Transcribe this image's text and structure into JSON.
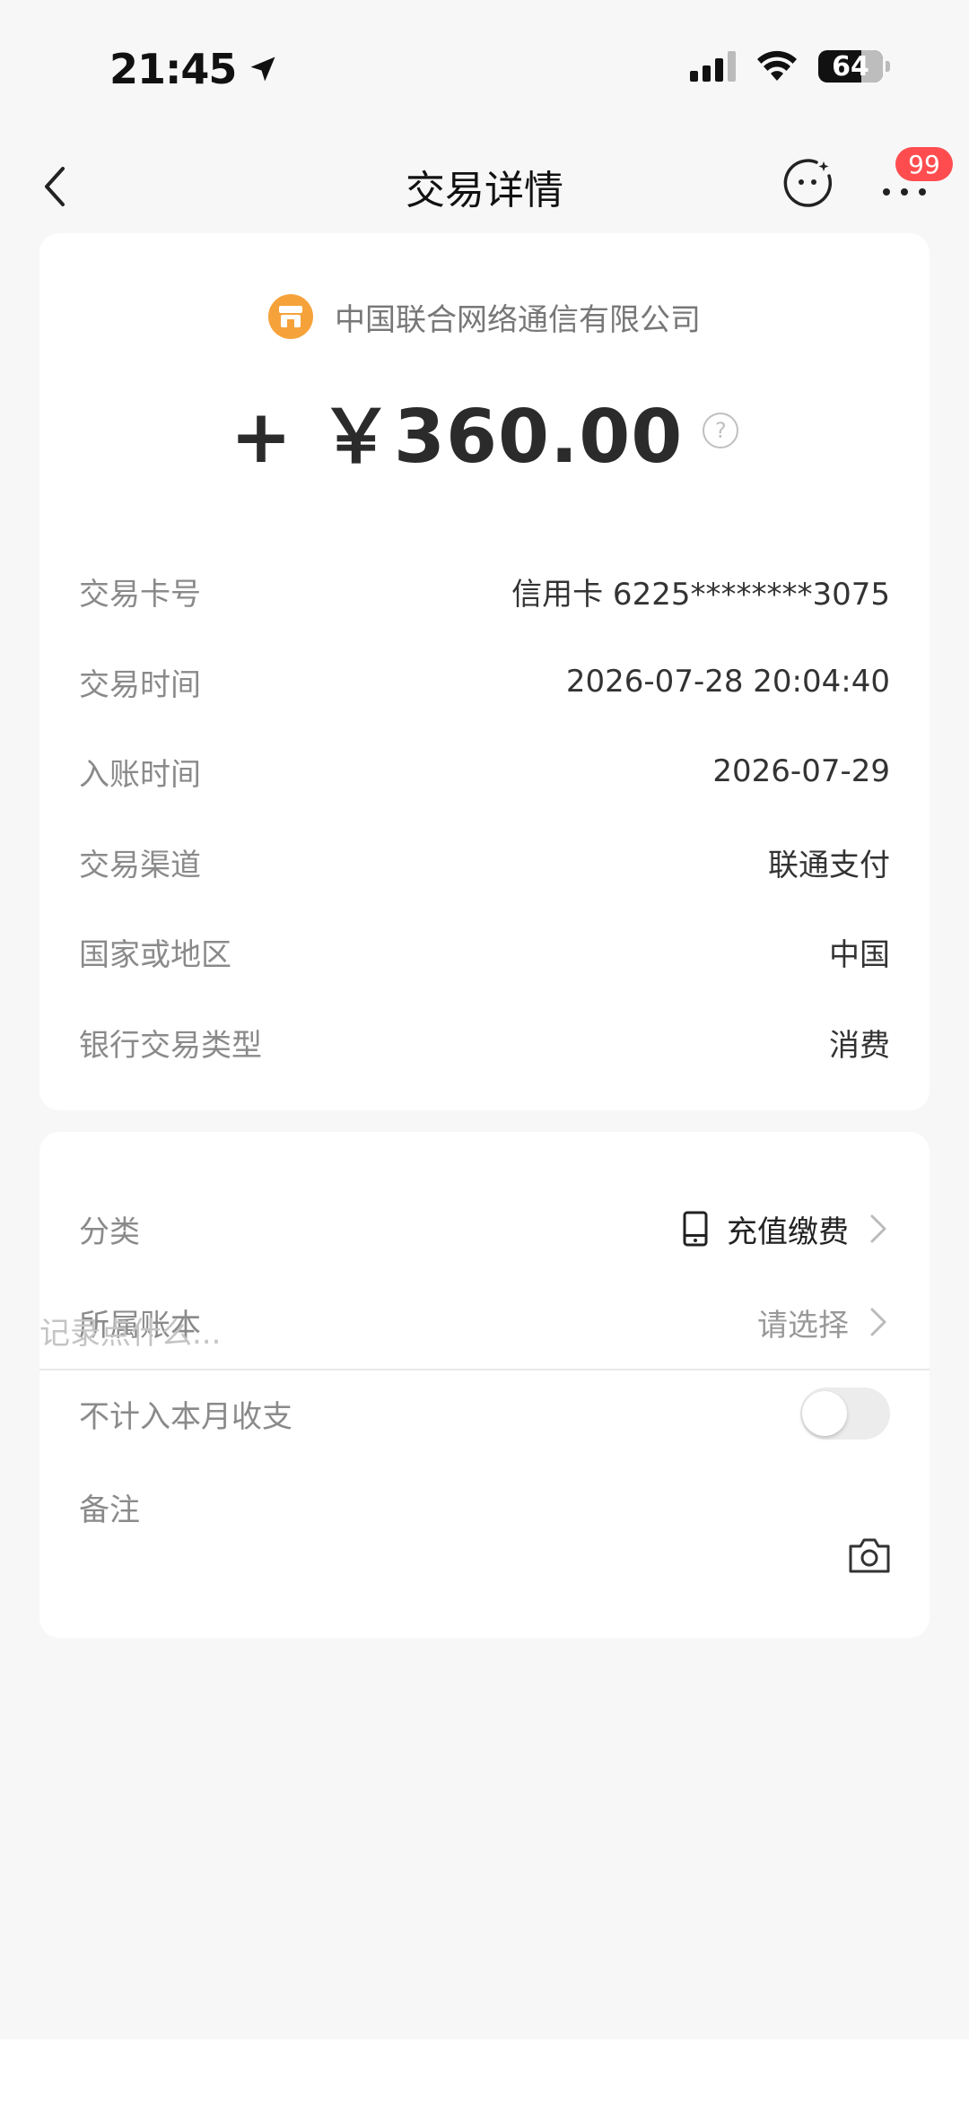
{
  "status_bar": {
    "time": "21:45",
    "battery": "64"
  },
  "nav": {
    "title": "交易详情",
    "badge": "99"
  },
  "transaction": {
    "merchant": "中国联合网络通信有限公司",
    "amount": "+ ￥360.00",
    "details": [
      {
        "label": "交易卡号",
        "value": "信用卡 6225********3075"
      },
      {
        "label": "交易时间",
        "value": "2026-07-28 20:04:40"
      },
      {
        "label": "入账时间",
        "value": "2026-07-29"
      },
      {
        "label": "交易渠道",
        "value": "联通支付"
      },
      {
        "label": "国家或地区",
        "value": "中国"
      },
      {
        "label": "银行交易类型",
        "value": "消费"
      }
    ]
  },
  "settings": {
    "category_label": "分类",
    "category_value": "充值缴费",
    "ledger_label": "所属账本",
    "ledger_value": "请选择",
    "exclude_label": "不计入本月收支",
    "exclude_on": false,
    "note_label": "备注",
    "note_placeholder": "记录点什么..."
  },
  "colors": {
    "accent_orange": "#f6a23a",
    "badge_red": "#ff4d4f",
    "background": "#f7f7f8"
  }
}
